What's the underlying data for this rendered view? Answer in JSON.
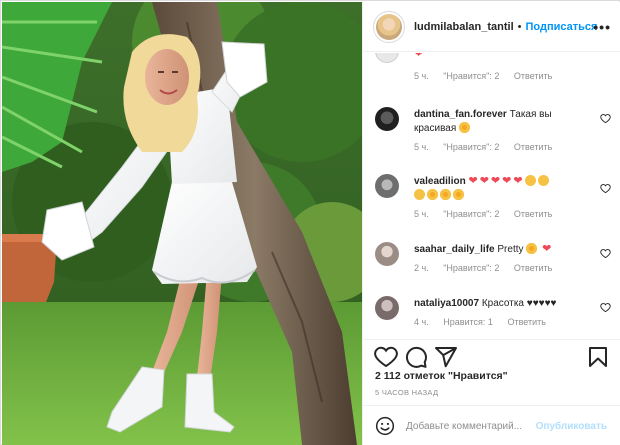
{
  "post": {
    "username": "ludmilabalan_tantil",
    "follow_label": "Подписаться",
    "more_label": "•••",
    "dot": "•"
  },
  "comments": [
    {
      "user": "",
      "text": "",
      "time": "5 ч.",
      "likes": "\"Нравится\": 2",
      "reply": "Ответить"
    },
    {
      "user": "dantina_fan.forever",
      "text": "Такая вы красивая",
      "time": "5 ч.",
      "likes": "\"Нравится\": 2",
      "reply": "Ответить"
    },
    {
      "user": "valeadilion",
      "text": "",
      "time": "5 ч.",
      "likes": "\"Нравится\": 2",
      "reply": "Ответить"
    },
    {
      "user": "saahar_daily_life",
      "text": "Pretty",
      "time": "2 ч.",
      "likes": "\"Нравится\": 2",
      "reply": "Ответить"
    },
    {
      "user": "nataliya10007",
      "text": "Красотка ♥♥♥♥♥",
      "time": "4 ч.",
      "likes": "Нравится: 1",
      "reply": "Ответить"
    }
  ],
  "likes_count": "2 112 отметок \"Нравится\"",
  "timestamp": "5 ЧАСОВ НАЗАД",
  "add_comment": {
    "placeholder": "Добавьте комментарий...",
    "post_label": "Опубликовать"
  },
  "colors": {
    "accent": "#0095f6",
    "like_red": "#ed4956",
    "muted": "#8e8e8e",
    "text": "#262626"
  },
  "icons": [
    "heart-icon",
    "comment-icon",
    "share-icon",
    "bookmark-icon",
    "smile-icon",
    "more-icon"
  ]
}
